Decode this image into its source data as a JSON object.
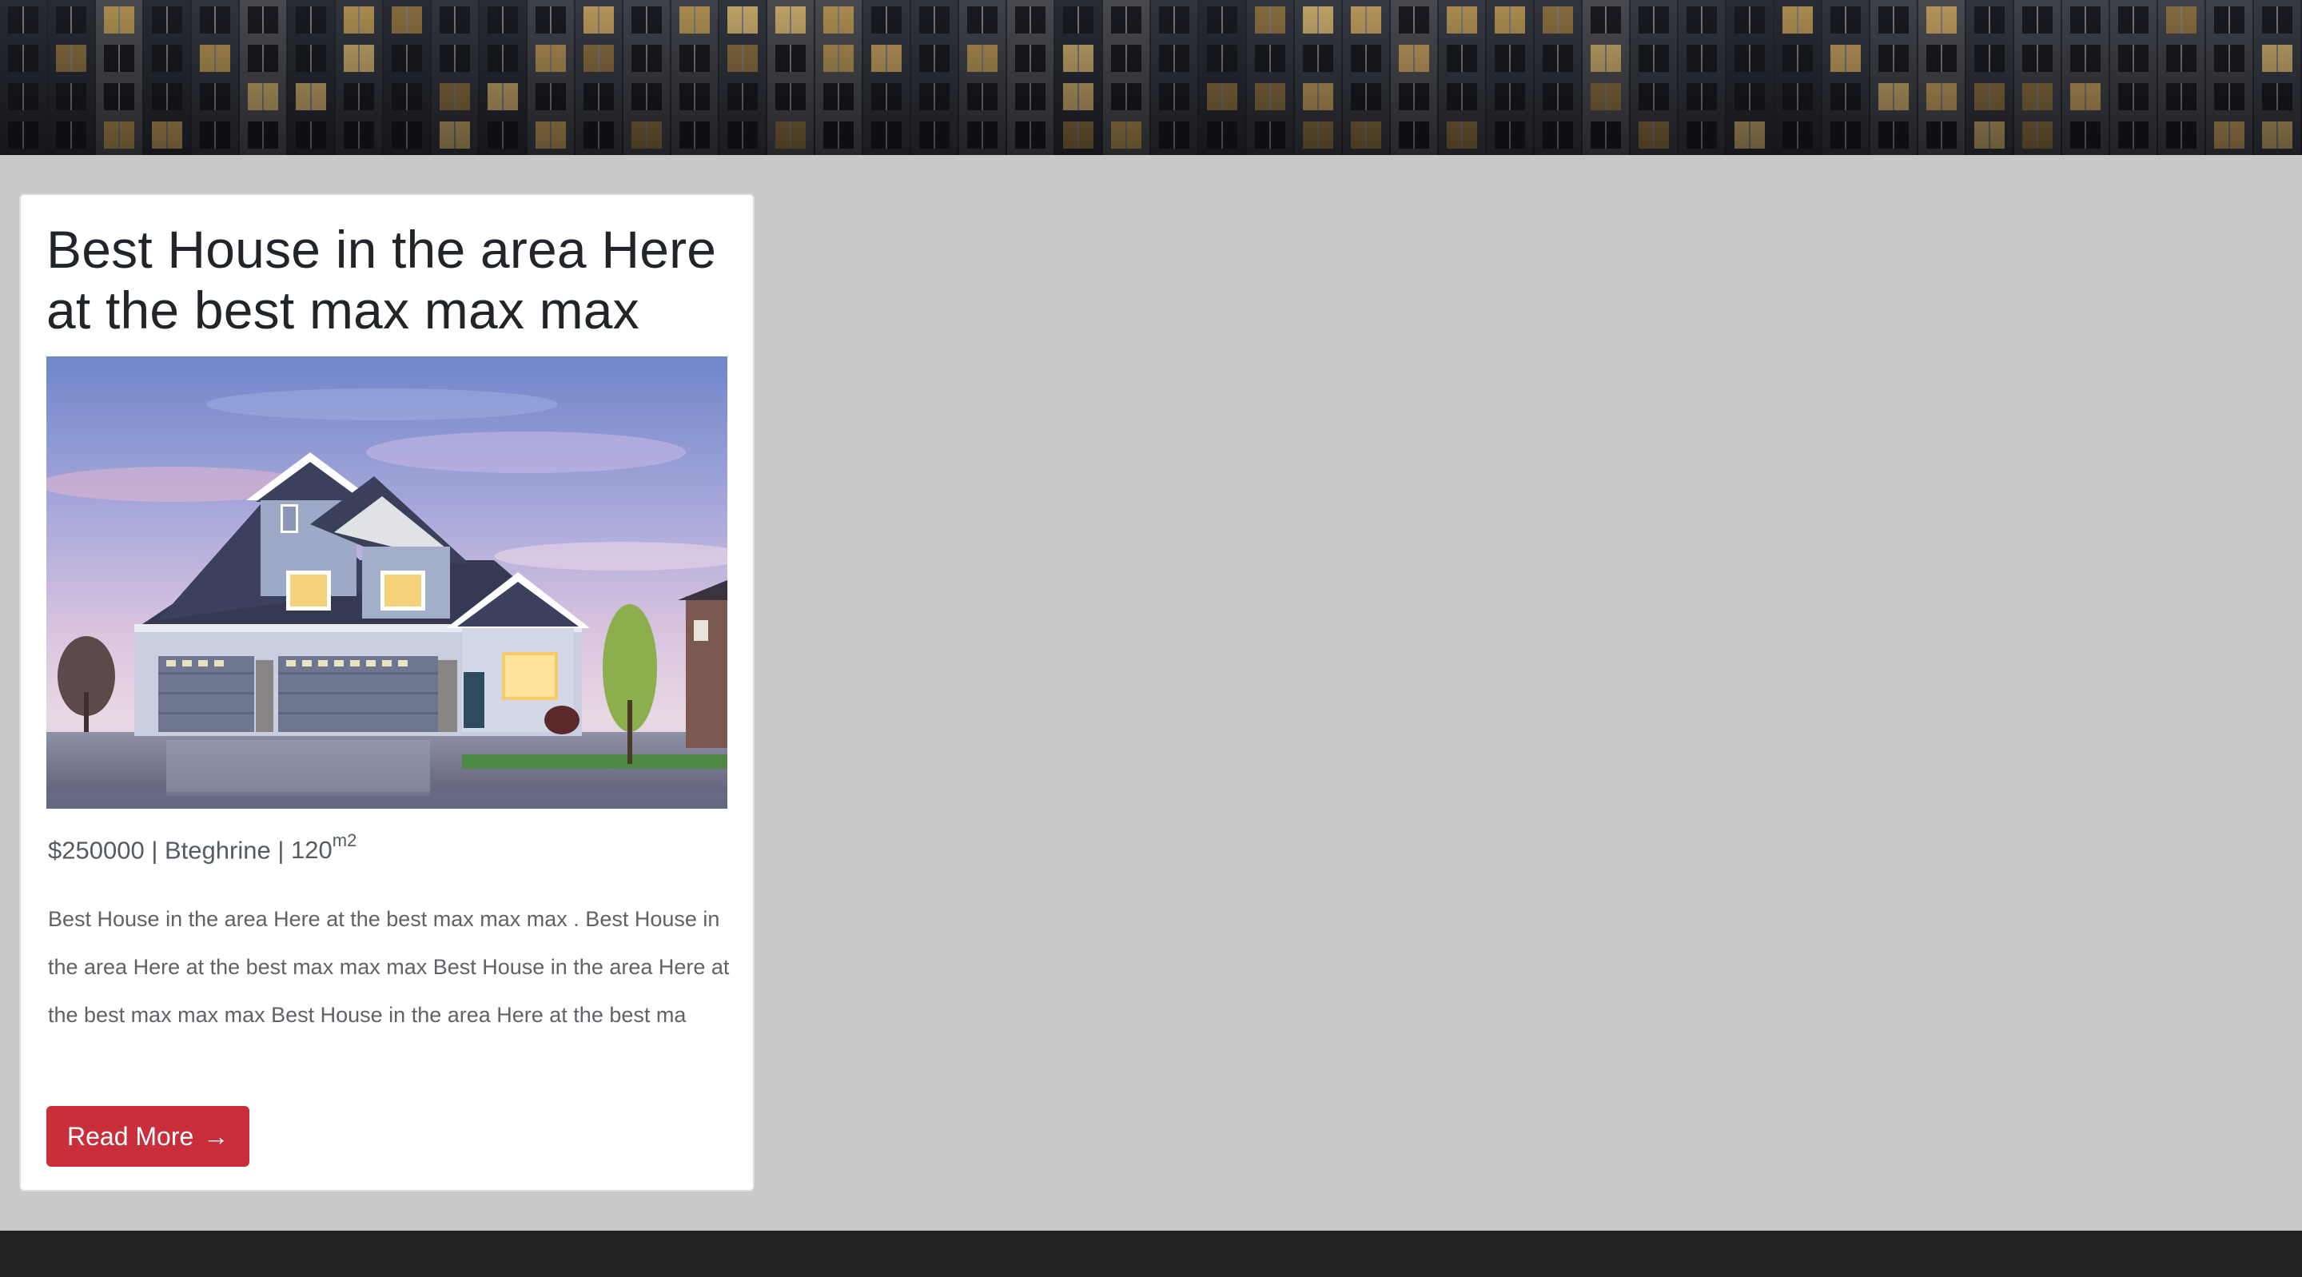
{
  "listing": {
    "title": "Best House in the area Here at the best max max max",
    "price": "$250000",
    "separator_1": "|",
    "location": "Bteghrine",
    "separator_2": "|",
    "area_value": "120",
    "area_unit": "m2",
    "description": "Best House in the area Here at the best max max max . Best House in the area Here at the best max max max Best House in the area Here at the best max max max Best House in the area Here at the best ma",
    "button_label": "Read More",
    "button_icon": "arrow-right-icon",
    "button_glyph": "→"
  },
  "colors": {
    "page_background": "#c9c9c9",
    "card_background": "#ffffff",
    "button_background": "#c82f3b",
    "footer_background": "#222222"
  }
}
